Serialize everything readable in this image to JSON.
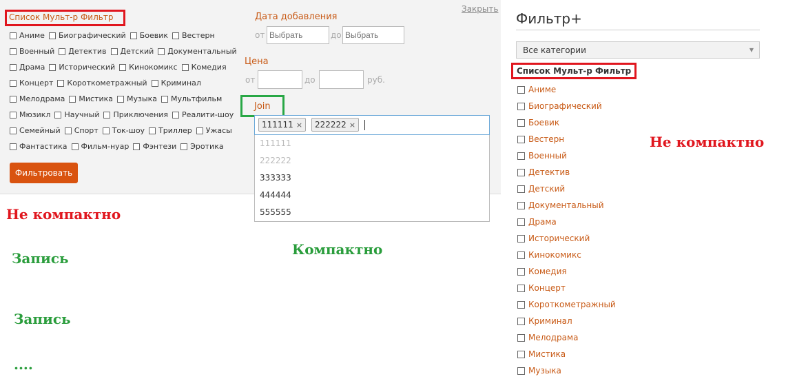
{
  "panel": {
    "title": "Список Мульт-р Фильтр",
    "close_label": "Закрыть",
    "genre_rows": [
      [
        "Аниме",
        "Биографический",
        "Боевик",
        "Вестерн"
      ],
      [
        "Военный",
        "Детектив",
        "Детский",
        "Документальный"
      ],
      [
        "Драма",
        "Исторический",
        "Кинокомикс",
        "Комедия"
      ],
      [
        "Концерт",
        "Короткометражный",
        "Криминал"
      ],
      [
        "Мелодрама",
        "Мистика",
        "Музыка",
        "Мультфильм"
      ],
      [
        "Мюзикл",
        "Научный",
        "Приключения",
        "Реалити-шоу"
      ],
      [
        "Семейный",
        "Спорт",
        "Ток-шоу",
        "Триллер",
        "Ужасы"
      ],
      [
        "Фантастика",
        "Фильм-нуар",
        "Фэнтези",
        "Эротика"
      ]
    ],
    "date_label": "Дата добавления",
    "from_label": "от",
    "to_label": "до",
    "date_from_placeholder": "Выбрать",
    "date_to_placeholder": "Выбрать",
    "price_label": "Цена",
    "price_from_label": "от",
    "price_to_label": "до",
    "price_unit": "руб.",
    "join_label": "Join",
    "selected_tags": [
      "111111",
      "222222"
    ],
    "tag_remove_symbol": "×",
    "options": [
      {
        "label": "111111",
        "selected": true
      },
      {
        "label": "222222",
        "selected": true
      },
      {
        "label": "333333",
        "selected": false
      },
      {
        "label": "444444",
        "selected": false
      },
      {
        "label": "555555",
        "selected": false
      }
    ],
    "filter_button": "Фильтровать"
  },
  "notes": {
    "not_compact_left": "Не компактно",
    "compact": "Компактно",
    "record_1": "Запись",
    "record_2": "Запись",
    "ellipsis": "....",
    "not_compact_right": "Не компактно"
  },
  "sidebar": {
    "title": "Фильтр+",
    "category_select": "Все категории",
    "list_title": "Список Мульт-р Фильтр",
    "items": [
      "Аниме",
      "Биографический",
      "Боевик",
      "Вестерн",
      "Военный",
      "Детектив",
      "Детский",
      "Документальный",
      "Драма",
      "Исторический",
      "Кинокомикс",
      "Комедия",
      "Концерт",
      "Короткометражный",
      "Криминал",
      "Мелодрама",
      "Мистика",
      "Музыка"
    ]
  },
  "colors": {
    "accent_orange": "#c85a16",
    "button_orange": "#d9530f",
    "annotation_red": "#e0161e",
    "annotation_green": "#2a9d3c"
  }
}
